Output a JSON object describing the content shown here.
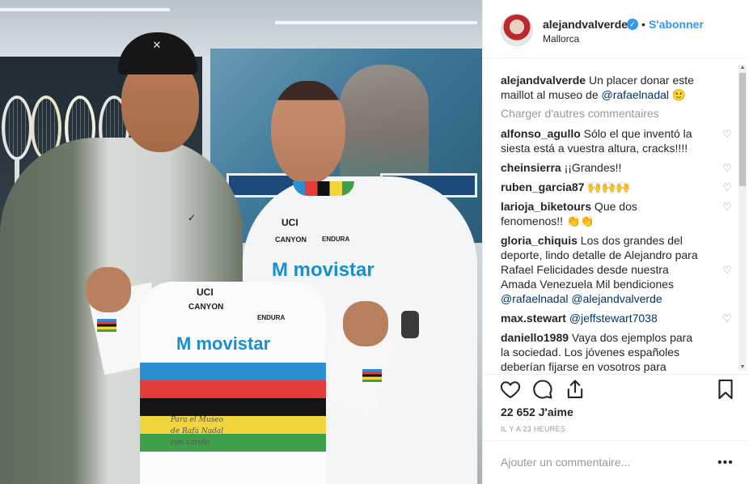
{
  "photo": {
    "description_brands": {
      "uci": "UCI",
      "canyon": "CANYON",
      "endura": "ENDURA",
      "movistar": "movistar",
      "m": "M",
      "nike": "✓"
    },
    "signature": [
      "Para el Museo",
      "de Rafa Nadal",
      "con cariño"
    ]
  },
  "header": {
    "username": "alejandvalverde",
    "verified_glyph": "✓",
    "separator": "•",
    "follow_label": "S'abonner",
    "location": "Mallorca"
  },
  "caption": {
    "user": "alejandvalverde",
    "text": " Un placer donar este maillot al museo de ",
    "mention": "@rafaelnadal",
    "emoji": " 🙂"
  },
  "load_more": "Charger d'autres commentaires",
  "comments": [
    {
      "user": "alfonso_agullo",
      "text": " Sólo el que inventó la siesta está a vuestra altura, cracks!!!!"
    },
    {
      "user": "cheinsierra",
      "text": " ¡¡Grandes!!"
    },
    {
      "user": "ruben_garcia87",
      "text": " 🙌🙌🙌"
    },
    {
      "user": "larioja_biketours",
      "text": " Que dos fenomenos!! 👏👏"
    },
    {
      "user": "gloria_chiquis",
      "text": " Los dos grandes del deporte, lindo detalle de Alejandro para Rafael Felicidades desde nuestra Amada Venezuela Mil bendiciones ",
      "mentions": "@rafaelnadal @alejandvalverde"
    },
    {
      "user": "max.stewart",
      "text": " ",
      "mentions": "@jeffstewart7038"
    },
    {
      "user": "daniello1989",
      "text": " Vaya dos ejemplos para la sociedad. Los jóvenes españoles deberían fijarse en vosotros para desarrollar"
    }
  ],
  "heart_glyph": "♡",
  "actions": {
    "likes_count": "22 652",
    "likes_label": " J'aime",
    "time": "IL Y A 23 HEURES"
  },
  "comment_box": {
    "placeholder": "Ajouter un commentaire...",
    "more": "•••"
  }
}
